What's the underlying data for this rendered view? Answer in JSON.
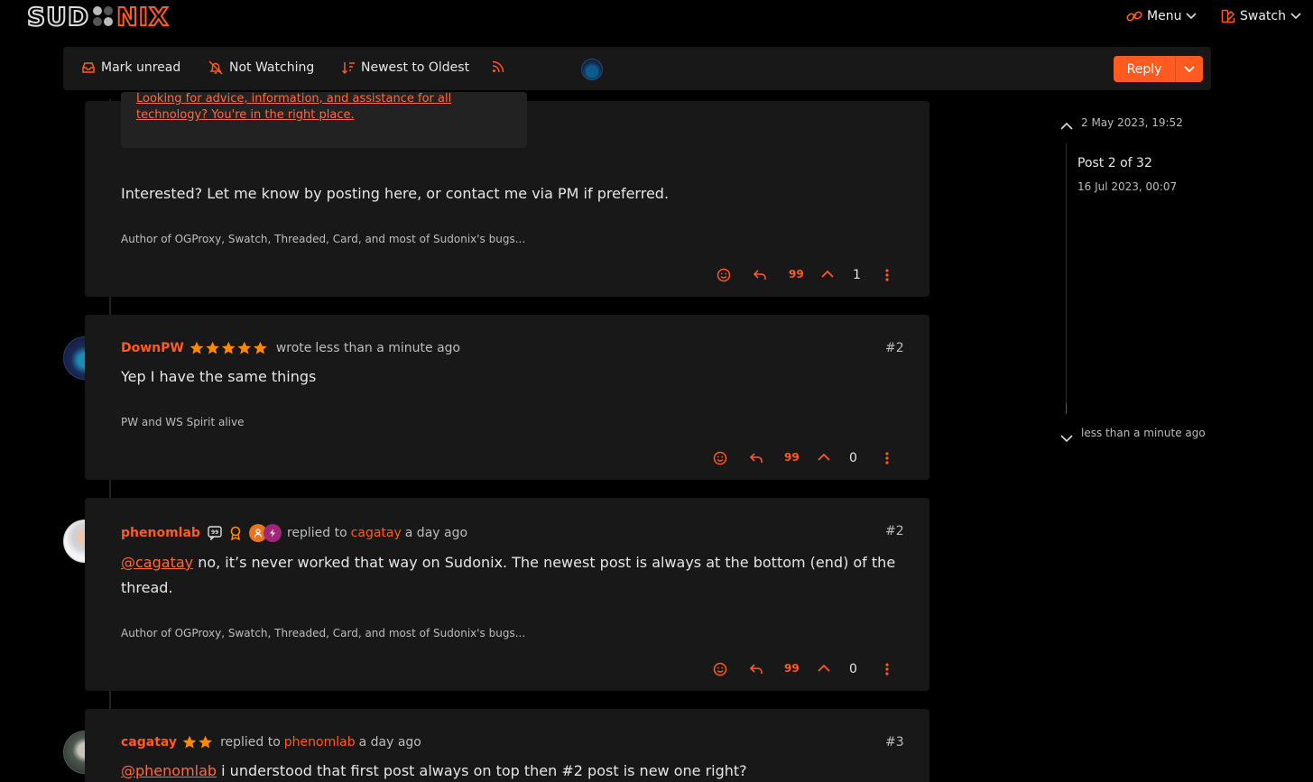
{
  "brand": {
    "logo_part1": "SUD",
    "logo_part2": "NIX"
  },
  "topnav": {
    "menu_label": "Menu",
    "swatch_label": "Swatch"
  },
  "toolbar": {
    "mark_unread": "Mark unread",
    "watching": "Not Watching",
    "sort": "Newest to Oldest",
    "reply": "Reply"
  },
  "colors": {
    "accent": "#ff5a1f",
    "card_bg": "#181818",
    "page_bg": "#000000",
    "online": "#2e9e4a"
  },
  "posts": [
    {
      "quote_link_line1": "Looking for advice, information, and assistance for all",
      "quote_link_line2": "technology? You're in the right place.",
      "content": "Interested? Let me know by posting here, or contact me via PM if preferred.",
      "signature": "Author of OGProxy, Swatch, Threaded, Card, and most of Sudonix's bugs...",
      "votes": "1"
    },
    {
      "author": "DownPW",
      "stars": 5,
      "action": "wrote",
      "time": "less than a minute ago",
      "number": "#2",
      "content": "Yep I have the same things",
      "signature": "PW and WS Spirit alive",
      "votes": "0"
    },
    {
      "author": "phenomlab",
      "action": "replied to",
      "reply_to": "cagatay",
      "time": "a day ago",
      "number": "#2",
      "mention": "@cagatay",
      "content_line1": " no, it’s never worked that way on Sudonix. The newest post is always at the bottom (end) of the",
      "content_line2": "thread.",
      "signature": "Author of OGProxy, Swatch, Threaded, Card, and most of Sudonix's bugs...",
      "votes": "0"
    },
    {
      "author": "cagatay",
      "stars": 2,
      "action": "replied to",
      "reply_to": "phenomlab",
      "time": "a day ago",
      "number": "#3",
      "mention": "@phenomlab",
      "content": " i understood that first post always on top then #2 post is new one right?"
    }
  ],
  "quote_label": "99",
  "sidebar": {
    "start_date": "2 May 2023, 19:52",
    "position": "Post 2 of 32",
    "position_date": "16 Jul 2023, 00:07",
    "end_date": "less than a minute ago"
  }
}
